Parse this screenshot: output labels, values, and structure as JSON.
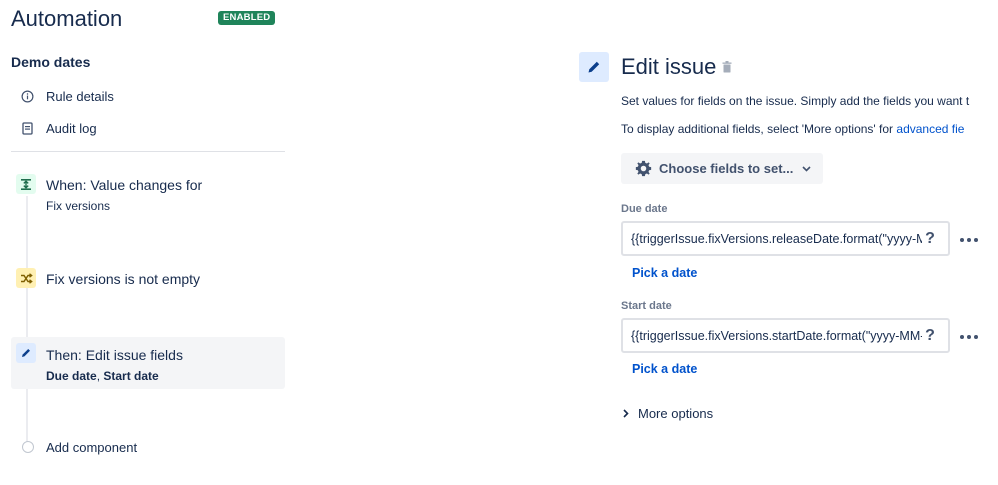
{
  "header": {
    "title": "Automation",
    "status_badge": "ENABLED"
  },
  "rule": {
    "name": "Demo dates"
  },
  "nav": [
    {
      "label": "Rule details",
      "icon": "info-icon"
    },
    {
      "label": "Audit log",
      "icon": "document-icon"
    }
  ],
  "steps": [
    {
      "title": "When: Value changes for",
      "subtitle": "Fix versions",
      "icon": "trigger-icon",
      "color": "#e3fcef"
    },
    {
      "title": "Fix versions is not empty",
      "icon": "condition-shuffle-icon",
      "color": "#fff0b3"
    },
    {
      "title": "Then: Edit issue fields",
      "subtitle_a": "Due date",
      "subtitle_sep": ", ",
      "subtitle_b": "Start date",
      "icon": "edit-pencil-icon",
      "color": "#deebff",
      "selected": true
    }
  ],
  "add_component": {
    "label": "Add component"
  },
  "editor": {
    "title": "Edit issue",
    "desc1": "Set values for fields on the issue. Simply add the fields you want t",
    "desc2_prefix": "To display additional fields, select 'More options' for ",
    "desc2_link": "advanced fie",
    "choose_button": "Choose fields to set...",
    "fields": [
      {
        "label": "Due date",
        "value": "{{triggerIssue.fixVersions.releaseDate.format(\"yyyy-MM-dd\")}}",
        "link": "Pick a date"
      },
      {
        "label": "Start date",
        "value": "{{triggerIssue.fixVersions.startDate.format(\"yyyy-MM-dd\")}}",
        "link": "Pick a date"
      }
    ],
    "more_options": "More options"
  },
  "colors": {
    "accent": "#0052cc",
    "badge": "#1f845a",
    "selected_bg": "#f4f5f7"
  }
}
